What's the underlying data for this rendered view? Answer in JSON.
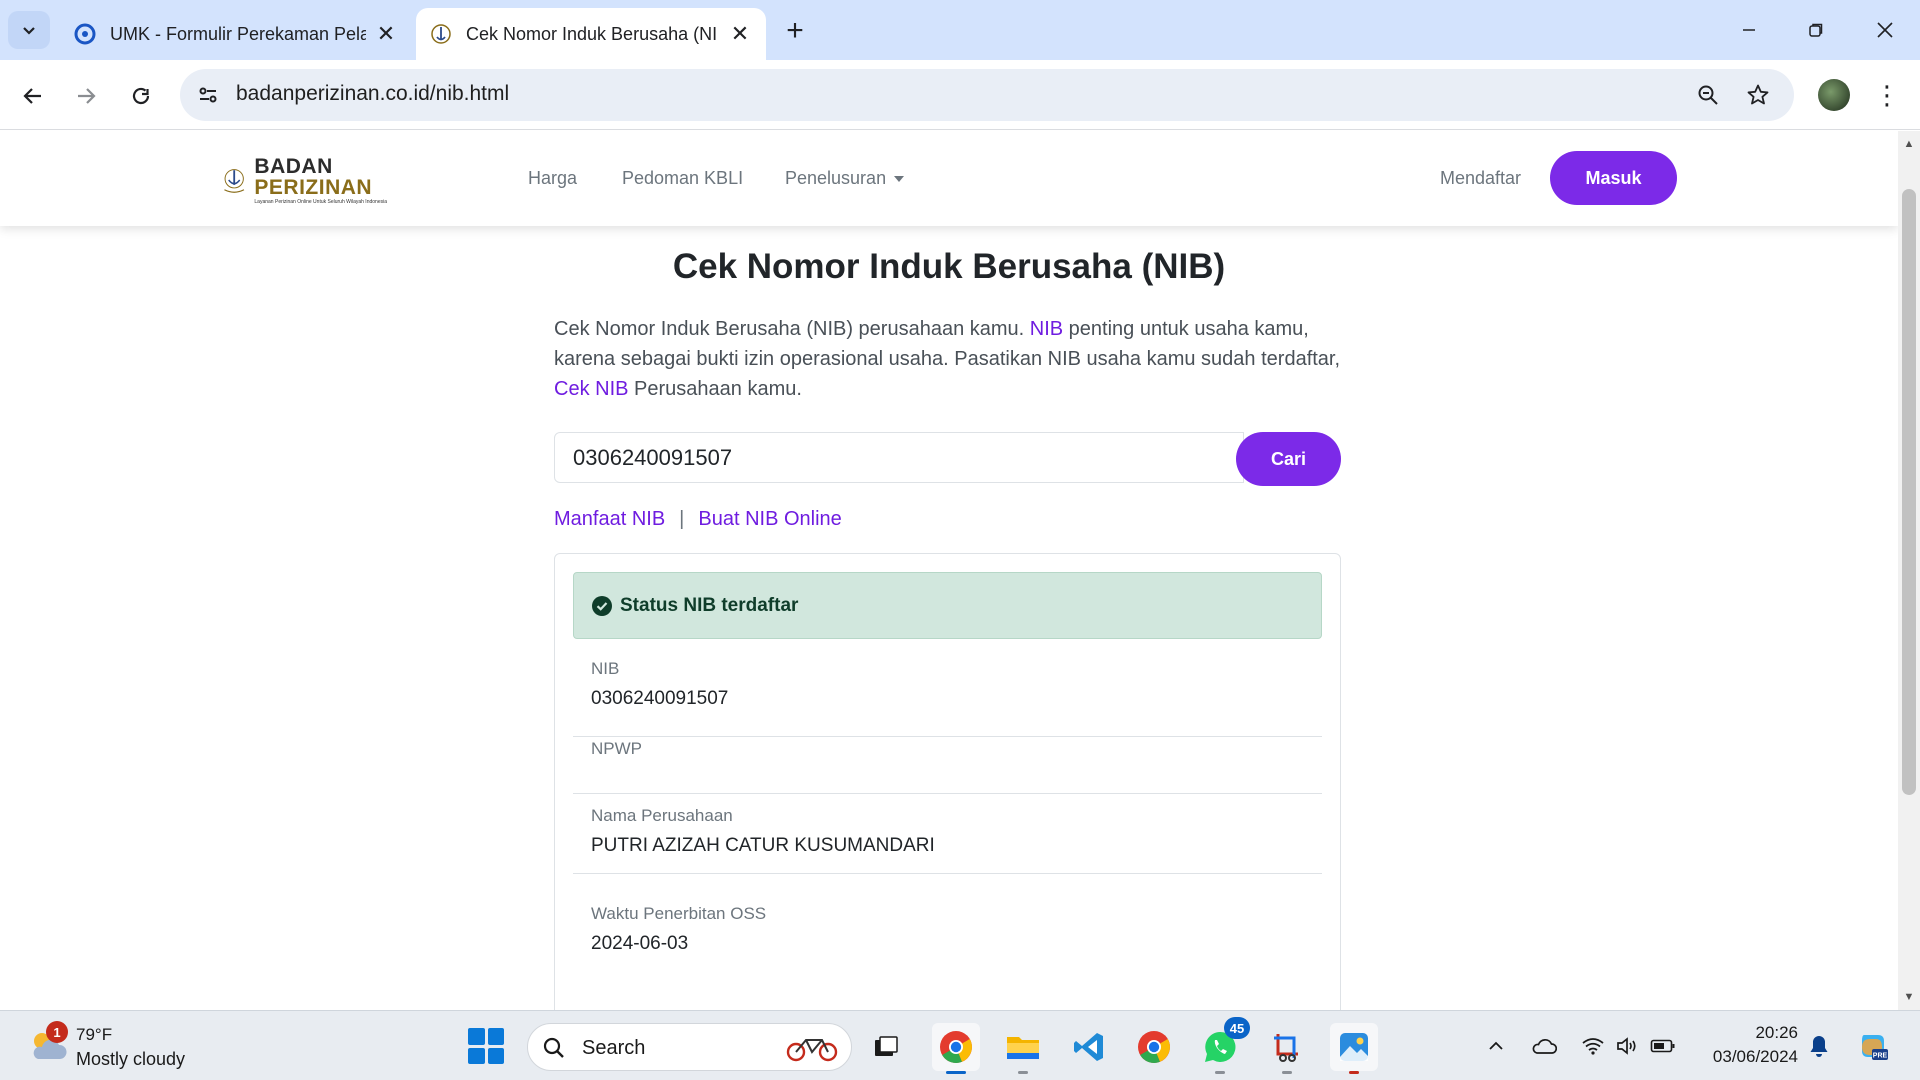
{
  "browser": {
    "tabs": [
      {
        "title": "UMK - Formulir Perekaman Pela",
        "active": false
      },
      {
        "title": "Cek Nomor Induk Berusaha (NI",
        "active": true
      }
    ],
    "url": "badanperizinan.co.id/nib.html"
  },
  "site": {
    "logo": {
      "line1": "BADAN",
      "line2": "PERIZINAN",
      "tagline": "Layanan Perizinan Online Untuk Seluruh Wilayah Indonesia"
    },
    "nav": {
      "harga": "Harga",
      "pedoman": "Pedoman KBLI",
      "penelusuran": "Penelusuran"
    },
    "mendaftar": "Mendaftar",
    "masuk": "Masuk",
    "accent_color": "#7c2ae8"
  },
  "main": {
    "title": "Cek Nomor Induk Berusaha (NIB)",
    "intro": {
      "p1": "Cek Nomor Induk Berusaha (NIB) perusahaan kamu. ",
      "link1": "NIB",
      "p2": " penting untuk usaha kamu, karena sebagai bukti izin operasional usaha. Pasatikan NIB usaha kamu sudah terdaftar, ",
      "link2": "Cek NIB",
      "p3": " Perusahaan kamu."
    },
    "search": {
      "value": "0306240091507",
      "button": "Cari"
    },
    "links": {
      "manfaat": "Manfaat NIB",
      "separator": "|",
      "buat": "Buat NIB Online"
    },
    "result": {
      "status": "Status NIB terdaftar",
      "status_color": "#d1e7dd",
      "fields": [
        {
          "label": "NIB",
          "value": "0306240091507"
        },
        {
          "label": "NPWP",
          "value": ""
        },
        {
          "label": "Nama Perusahaan",
          "value": "PUTRI AZIZAH CATUR KUSUMANDARI"
        },
        {
          "label": "Waktu Penerbitan OSS",
          "value": "2024-06-03"
        }
      ]
    }
  },
  "taskbar": {
    "weather": {
      "temp": "79°F",
      "desc": "Mostly cloudy",
      "badge": "1"
    },
    "search_placeholder": "Search",
    "whatsapp_badge": "45",
    "time": "20:26",
    "date": "03/06/2024"
  }
}
